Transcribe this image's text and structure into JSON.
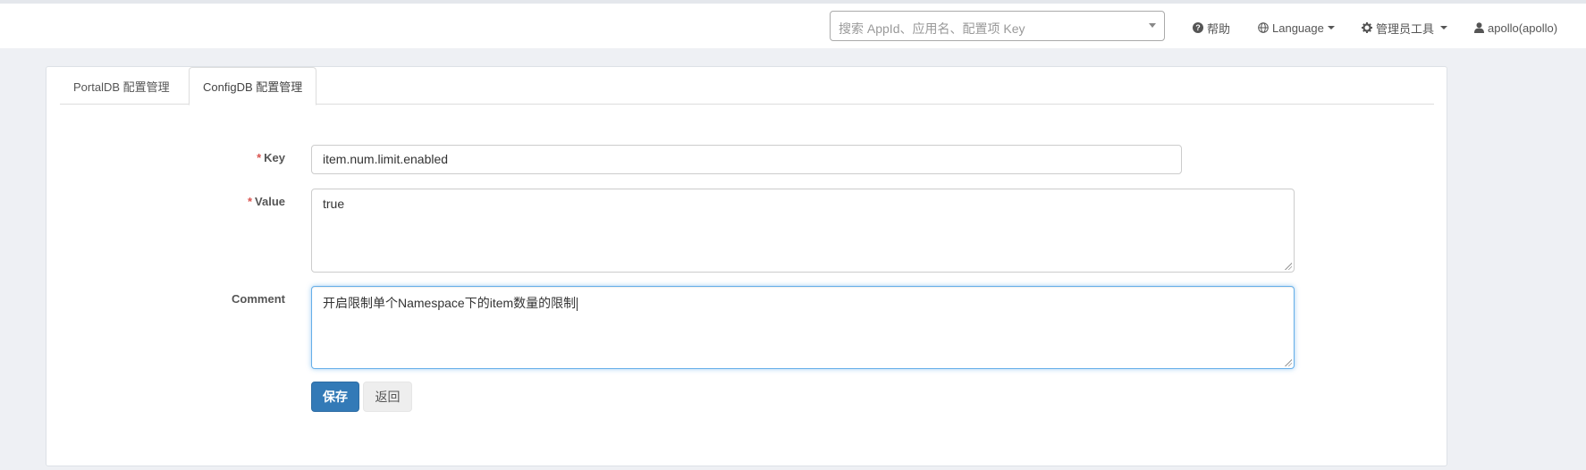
{
  "header": {
    "search": {
      "placeholder": "搜索 AppId、应用名、配置项 Key"
    },
    "help_label": "帮助",
    "language_label": "Language",
    "admin_tools_label": "管理员工具",
    "user_label": "apollo(apollo)"
  },
  "tabs": [
    {
      "label": "PortalDB 配置管理",
      "active": false
    },
    {
      "label": "ConfigDB 配置管理",
      "active": true
    }
  ],
  "form": {
    "required_mark": "*",
    "key": {
      "label": "Key",
      "value": "item.num.limit.enabled"
    },
    "value": {
      "label": "Value",
      "value": "true"
    },
    "comment": {
      "label": "Comment",
      "value": "开启限制单个Namespace下的item数量的限制"
    }
  },
  "buttons": {
    "save_label": "保存",
    "back_label": "返回"
  },
  "colors": {
    "primary": "#337ab7",
    "required": "#d9534f",
    "focus_border": "#66afe9"
  }
}
